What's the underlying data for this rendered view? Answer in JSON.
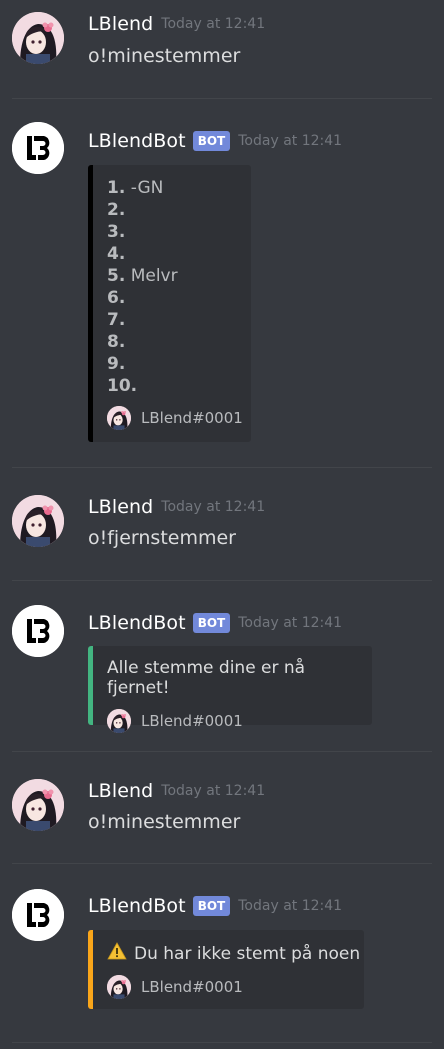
{
  "user": {
    "name": "LBlend"
  },
  "bot": {
    "name": "LBlendBot",
    "tag": "BOT"
  },
  "messages": [
    {
      "timestamp": "Today at 12:41",
      "content": "o!minestemmer"
    },
    {
      "timestamp": "Today at 12:41",
      "embed": {
        "color": "#000000",
        "ranks": [
          {
            "number": "1.",
            "name": "-GN"
          },
          {
            "number": "2.",
            "name": ""
          },
          {
            "number": "3.",
            "name": ""
          },
          {
            "number": "4.",
            "name": ""
          },
          {
            "number": "5.",
            "name": "Melvr"
          },
          {
            "number": "6.",
            "name": ""
          },
          {
            "number": "7.",
            "name": ""
          },
          {
            "number": "8.",
            "name": ""
          },
          {
            "number": "9.",
            "name": ""
          },
          {
            "number": "10.",
            "name": ""
          }
        ],
        "footer": "LBlend#0001"
      }
    },
    {
      "timestamp": "Today at 12:41",
      "content": "o!fjernstemmer"
    },
    {
      "timestamp": "Today at 12:41",
      "embed": {
        "color": "#43b581",
        "description": "Alle stemme dine er nå fjernet!",
        "footer": "LBlend#0001"
      }
    },
    {
      "timestamp": "Today at 12:41",
      "content": "o!minestemmer"
    },
    {
      "timestamp": "Today at 12:41",
      "embed": {
        "color": "#faa61a",
        "icon": "warning-icon",
        "description": "Du har ikke stemt på noen",
        "footer": "LBlend#0001"
      }
    }
  ]
}
